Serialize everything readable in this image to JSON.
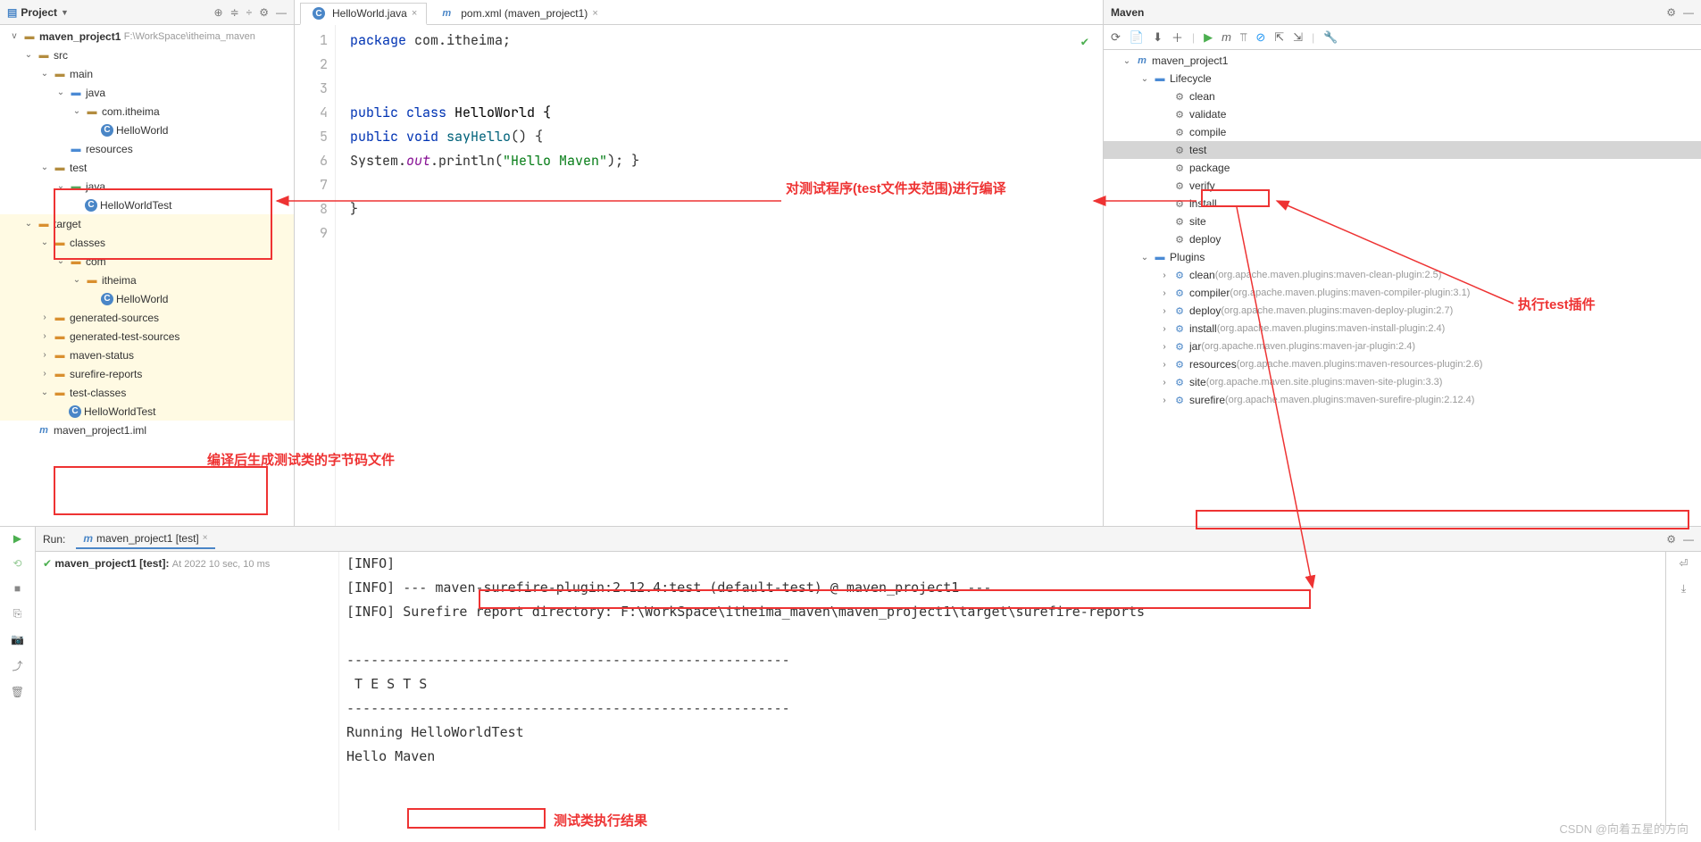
{
  "project": {
    "title": "Project",
    "root": {
      "name": "maven_project1",
      "path": "F:\\WorkSpace\\itheima_maven"
    },
    "tree": [
      {
        "lvl": 0,
        "chev": "v",
        "icon": "folder",
        "label": "src",
        "bold": false,
        "bg": ""
      },
      {
        "lvl": 1,
        "chev": "v",
        "icon": "folder",
        "label": "main",
        "bold": false,
        "bg": ""
      },
      {
        "lvl": 2,
        "chev": "v",
        "icon": "folder-blue",
        "label": "java",
        "bold": false,
        "bg": ""
      },
      {
        "lvl": 3,
        "chev": "v",
        "icon": "folder",
        "label": "com.itheima",
        "bold": false,
        "bg": ""
      },
      {
        "lvl": 4,
        "chev": " ",
        "icon": "class",
        "label": "HelloWorld",
        "bold": false,
        "bg": ""
      },
      {
        "lvl": 2,
        "chev": " ",
        "icon": "folder-blue",
        "label": "resources",
        "bold": false,
        "bg": ""
      },
      {
        "lvl": 1,
        "chev": "v",
        "icon": "folder",
        "label": "test",
        "bold": false,
        "bg": ""
      },
      {
        "lvl": 2,
        "chev": "v",
        "icon": "folder-green",
        "label": "java",
        "bold": false,
        "bg": ""
      },
      {
        "lvl": 3,
        "chev": " ",
        "icon": "class",
        "label": "HelloWorldTest",
        "bold": false,
        "bg": ""
      },
      {
        "lvl": 0,
        "chev": "v",
        "icon": "folder-orange",
        "label": "target",
        "bold": false,
        "bg": "t"
      },
      {
        "lvl": 1,
        "chev": "v",
        "icon": "folder-orange",
        "label": "classes",
        "bold": false,
        "bg": "t"
      },
      {
        "lvl": 2,
        "chev": "v",
        "icon": "folder-orange",
        "label": "com",
        "bold": false,
        "bg": "t"
      },
      {
        "lvl": 3,
        "chev": "v",
        "icon": "folder-orange",
        "label": "itheima",
        "bold": false,
        "bg": "t"
      },
      {
        "lvl": 4,
        "chev": " ",
        "icon": "class",
        "label": "HelloWorld",
        "bold": false,
        "bg": "t"
      },
      {
        "lvl": 1,
        "chev": ">",
        "icon": "folder-orange",
        "label": "generated-sources",
        "bold": false,
        "bg": "t"
      },
      {
        "lvl": 1,
        "chev": ">",
        "icon": "folder-orange",
        "label": "generated-test-sources",
        "bold": false,
        "bg": "t"
      },
      {
        "lvl": 1,
        "chev": ">",
        "icon": "folder-orange",
        "label": "maven-status",
        "bold": false,
        "bg": "t"
      },
      {
        "lvl": 1,
        "chev": ">",
        "icon": "folder-orange",
        "label": "surefire-reports",
        "bold": false,
        "bg": "t"
      },
      {
        "lvl": 1,
        "chev": "v",
        "icon": "folder-orange",
        "label": "test-classes",
        "bold": false,
        "bg": "t"
      },
      {
        "lvl": 2,
        "chev": " ",
        "icon": "class",
        "label": "HelloWorldTest",
        "bold": false,
        "bg": "t"
      },
      {
        "lvl": 0,
        "chev": " ",
        "icon": "maven",
        "label": "maven_project1.iml",
        "bold": false,
        "bg": ""
      }
    ]
  },
  "editor": {
    "tabs": [
      {
        "icon": "class",
        "label": "HelloWorld.java",
        "active": true
      },
      {
        "icon": "maven",
        "label": "pom.xml (maven_project1)",
        "active": false
      }
    ],
    "lines": [
      "1",
      "2",
      "3",
      "4",
      "5",
      "6",
      "7",
      "8",
      "9"
    ],
    "code": {
      "l1a": "package ",
      "l1b": "com.itheima;",
      "l4a": "public class ",
      "l4b": "HelloWorld {",
      "l5a": "    public void ",
      "l5b": "sayHello",
      "l5c": "() {",
      "l6a": "        System.",
      "l6b": "out",
      "l6c": ".println(",
      "l6d": "\"Hello Maven\"",
      "l6e": "); }",
      "l8": "}"
    }
  },
  "maven": {
    "title": "Maven",
    "root": "maven_project1",
    "lifecycle_label": "Lifecycle",
    "lifecycle": [
      "clean",
      "validate",
      "compile",
      "test",
      "package",
      "verify",
      "install",
      "site",
      "deploy"
    ],
    "plugins_label": "Plugins",
    "plugins": [
      {
        "name": "clean",
        "note": "(org.apache.maven.plugins:maven-clean-plugin:2.5)"
      },
      {
        "name": "compiler",
        "note": "(org.apache.maven.plugins:maven-compiler-plugin:3.1)"
      },
      {
        "name": "deploy",
        "note": "(org.apache.maven.plugins:maven-deploy-plugin:2.7)"
      },
      {
        "name": "install",
        "note": "(org.apache.maven.plugins:maven-install-plugin:2.4)"
      },
      {
        "name": "jar",
        "note": "(org.apache.maven.plugins:maven-jar-plugin:2.4)"
      },
      {
        "name": "resources",
        "note": "(org.apache.maven.plugins:maven-resources-plugin:2.6)"
      },
      {
        "name": "site",
        "note": "(org.apache.maven.site.plugins:maven-site-plugin:3.3)"
      },
      {
        "name": "surefire",
        "note": "(org.apache.maven.plugins:maven-surefire-plugin:2.12.4)"
      }
    ]
  },
  "run": {
    "label": "Run:",
    "tab": "maven_project1 [test]",
    "result_name": "maven_project1 [test]:",
    "result_time": "At 2022 10 sec, 10 ms",
    "console": "[INFO]\n[INFO] --- maven-surefire-plugin:2.12.4:test (default-test) @ maven_project1 ---\n[INFO] Surefire report directory: F:\\WorkSpace\\itheima_maven\\maven_project1\\target\\surefire-reports\n\n-------------------------------------------------------\n T E S T S\n-------------------------------------------------------\nRunning HelloWorldTest\nHello Maven"
  },
  "annotations": {
    "a1": "对测试程序(test文件夹范围)进行编译",
    "a2": "执行test插件",
    "a3": "编译后生成测试类的字节码文件",
    "a4": "测试类执行结果"
  },
  "watermark": "CSDN @向着五星的方向"
}
